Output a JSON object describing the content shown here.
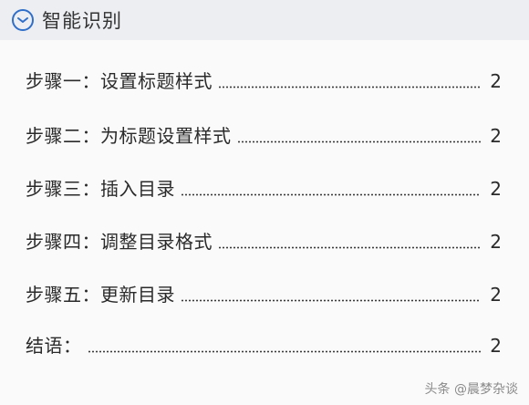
{
  "header": {
    "title": "智能识别",
    "icon": "chevron-circle-icon"
  },
  "toc": {
    "entries": [
      {
        "label": "步骤一：设置标题样式",
        "page": "2"
      },
      {
        "label": "步骤二：为标题设置样式",
        "page": "2"
      },
      {
        "label": "步骤三：插入目录",
        "page": "2"
      },
      {
        "label": "步骤四：调整目录格式",
        "page": "2"
      },
      {
        "label": "步骤五：更新目录",
        "page": "2"
      },
      {
        "label": "结语：",
        "page": "2"
      }
    ]
  },
  "watermark": "头条 @晨梦杂谈",
  "colors": {
    "icon_blue": "#2f6fc9",
    "header_bg": "#eceef2",
    "panel_bg": "#fafafa"
  }
}
